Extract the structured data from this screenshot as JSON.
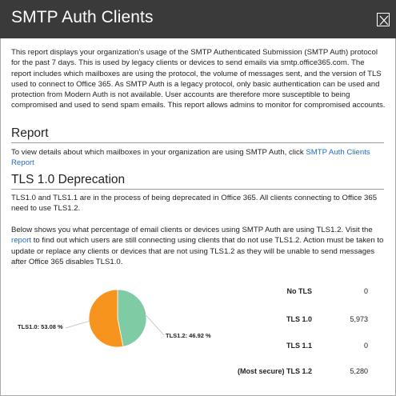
{
  "dialog": {
    "title": "SMTP Auth Clients",
    "close_icon": "close-icon"
  },
  "intro": {
    "text": "This report displays your organization's usage of the SMTP Authenticated Submission (SMTP Auth) protocol for the past 7 days. This is used by legacy clients or devices to send emails via smtp.office365.com. The report includes which mailboxes are using the protocol, the volume of messages sent, and the version of TLS used to connect to Office 365. As SMTP Auth is a legacy protocol, only basic authentication can be used and protection from Modern Auth is not available. User accounts are therefore more susceptible to being compromised and used to send spam emails. This report allows admins to monitor for compromised accounts."
  },
  "report": {
    "heading": "Report",
    "text_before_link": "To view details about which mailboxes in your organization are using SMTP Auth, click ",
    "link_label": "SMTP Auth Clients Report"
  },
  "tls": {
    "heading": "TLS 1.0 Deprecation",
    "para1": "TLS1.0 and TLS1.1 are in the process of being deprecated in Office 365. All clients connecting to Office 365 need to use TLS1.2.",
    "para2_before_link": "Below shows you what percentage of email clients or devices using SMTP Auth are using TLS1.2. Visit the ",
    "para2_link": "report",
    "para2_after_link": " to find out which users are still connecting using clients that do not use TLS1.2. Action must be taken to update or replace any clients or devices that are not using TLS1.2 as they will be unable to send messages after Office 365 disables TLS1.0."
  },
  "chart_data": {
    "type": "pie",
    "slices": [
      {
        "label": "TLS1.0: 53.08 %",
        "value": 53.08,
        "color": "#f7941d"
      },
      {
        "label": "TLS1.2: 46.92 %",
        "value": 46.92,
        "color": "#7fcba4"
      }
    ]
  },
  "tls_table": [
    {
      "label": "No TLS",
      "value": "0"
    },
    {
      "label": "TLS 1.0",
      "value": "5,973"
    },
    {
      "label": "TLS 1.1",
      "value": "0"
    },
    {
      "label": "(Most secure) TLS 1.2",
      "value": "5,280"
    }
  ],
  "colors": {
    "header_bg": "#3a3a3a",
    "link": "#1e6cc6",
    "pie_tls10": "#f7941d",
    "pie_tls12": "#7fcba4"
  }
}
